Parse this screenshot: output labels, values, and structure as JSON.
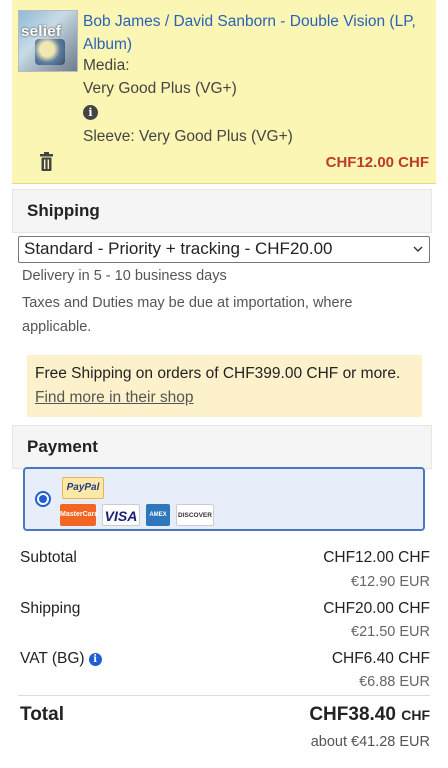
{
  "item": {
    "thumb_label": "selief",
    "title": "Bob James / David Sanborn - Double Vision (LP, Album)",
    "media_label": "Media:",
    "media_condition": "Very Good Plus (VG+)",
    "sleeve": "Sleeve: Very Good Plus (VG+)",
    "price": "CHF12.00 CHF"
  },
  "shipping": {
    "heading": "Shipping",
    "selected_option": "Standard - Priority + tracking - CHF20.00",
    "delivery": "Delivery in 5 - 10 business days",
    "taxes_line1": "Taxes and Duties may be due at importation, where",
    "taxes_line2": "applicable.",
    "promo_text": "Free Shipping on orders of CHF399.00 CHF or more.",
    "promo_link": "Find more in their shop"
  },
  "payment": {
    "heading": "Payment",
    "paypal": "PayPal",
    "cards": [
      "MasterCard",
      "VISA",
      "AMEX",
      "DISCOVER"
    ]
  },
  "totals": {
    "subtotal_label": "Subtotal",
    "subtotal": "CHF12.00 CHF",
    "subtotal_eur": "€12.90 EUR",
    "shipping_label": "Shipping",
    "shipping": "CHF20.00 CHF",
    "shipping_eur": "€21.50 EUR",
    "vat_label": "VAT (BG)",
    "vat": "CHF6.40 CHF",
    "vat_eur": "€6.88 EUR",
    "total_label": "Total",
    "total_amount": "CHF38.40",
    "total_currency": "CHF",
    "about": "about €41.28 EUR"
  },
  "colors": {
    "item_bg": "#fbf6b3",
    "link": "#2a62b8",
    "price_red": "#c0392b",
    "promo_bg": "#fdf1cc",
    "payment_border": "#4a78c0"
  }
}
